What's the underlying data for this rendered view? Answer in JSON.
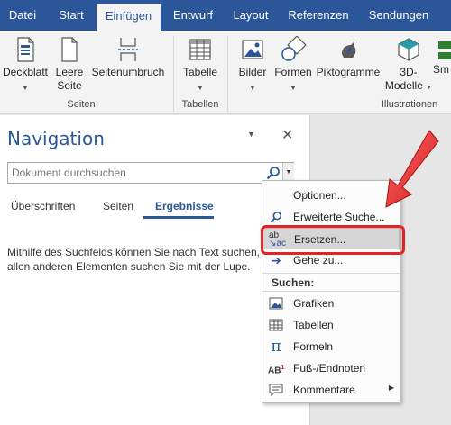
{
  "tabs": [
    {
      "label": "Datei"
    },
    {
      "label": "Start"
    },
    {
      "label": "Einfügen"
    },
    {
      "label": "Entwurf"
    },
    {
      "label": "Layout"
    },
    {
      "label": "Referenzen"
    },
    {
      "label": "Sendungen"
    }
  ],
  "ribbon": {
    "deckblatt": "Deckblatt",
    "leere_seite_1": "Leere",
    "leere_seite_2": "Seite",
    "seitenumbruch": "Seitenumbruch",
    "group_seiten": "Seiten",
    "tabelle": "Tabelle",
    "group_tabellen": "Tabellen",
    "bilder": "Bilder",
    "formen": "Formen",
    "piktogramme": "Piktogramme",
    "d3_1": "3D-",
    "d3_2": "Modelle",
    "sm": "Sm",
    "group_illustrationen": "Illustrationen"
  },
  "navigation": {
    "title": "Navigation",
    "search_placeholder": "Dokument durchsuchen",
    "tabs": [
      {
        "label": "Überschriften"
      },
      {
        "label": "Seiten"
      },
      {
        "label": "Ergebnisse"
      }
    ],
    "info_text": "Mithilfe des Suchfelds können Sie nach Text suchen, n allen anderen Elementen suchen Sie mit der Lupe."
  },
  "menu": {
    "items_top": [
      {
        "label": "Optionen...",
        "icon": "none"
      },
      {
        "label": "Erweiterte Suche...",
        "icon": "search-icon"
      },
      {
        "label": "Ersetzen...",
        "icon": "replace-icon"
      },
      {
        "label": "Gehe zu...",
        "icon": "arrow-right-icon"
      }
    ],
    "section_header": "Suchen:",
    "items_bottom": [
      {
        "label": "Grafiken",
        "icon": "image-icon"
      },
      {
        "label": "Tabellen",
        "icon": "table-icon"
      },
      {
        "label": "Formeln",
        "icon": "pi-icon"
      },
      {
        "label": "Fuß-/Endnoten",
        "icon": "footnote-icon"
      },
      {
        "label": "Kommentare",
        "icon": "comment-icon"
      }
    ]
  },
  "colors": {
    "accent": "#2b579a",
    "highlight_border": "#e32424"
  }
}
